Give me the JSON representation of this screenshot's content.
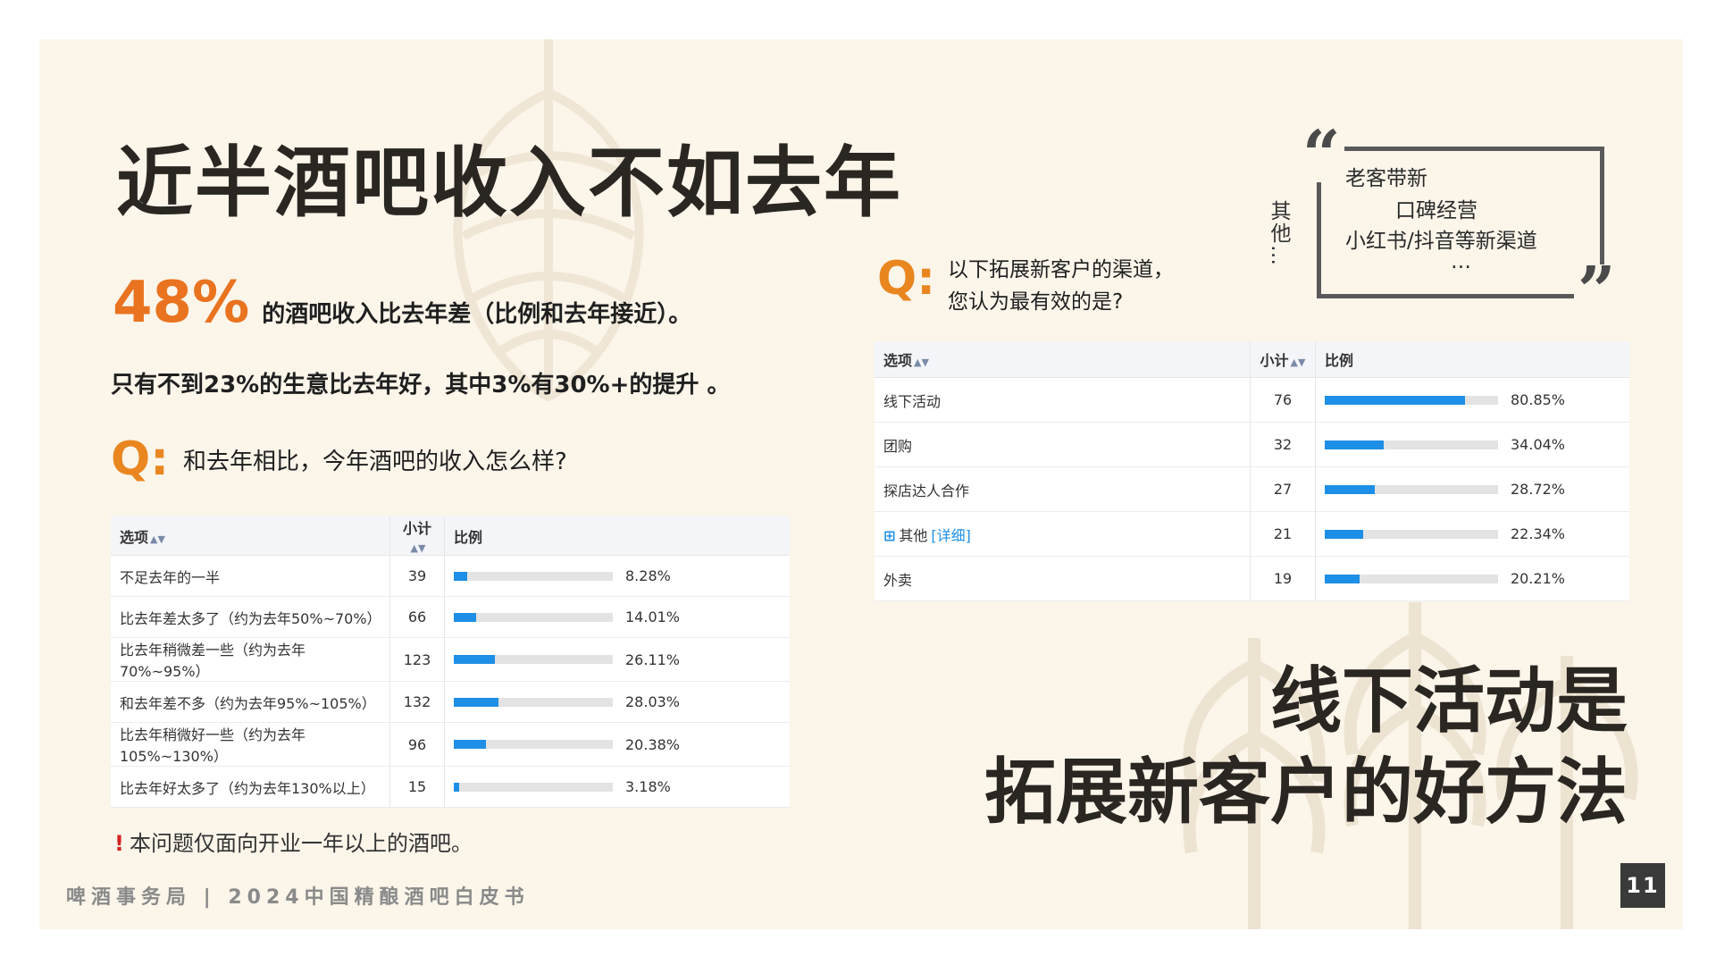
{
  "title": "近半酒吧收入不如去年",
  "stat": {
    "percent": "48%",
    "text": "的酒吧收入比去年差（比例和去年接近）。",
    "subline": "只有不到23%的生意比去年好，其中3%有30%+的提升 。"
  },
  "q_mark": "Q:",
  "q1": {
    "question": "和去年相比，今年酒吧的收入怎么样?",
    "headers": {
      "option": "选项",
      "count": "小计",
      "ratio": "比例"
    },
    "rows": [
      {
        "option": "不足去年的一半",
        "count": "39",
        "pct_label": "8.28%",
        "pct": 8.28
      },
      {
        "option": "比去年差太多了（约为去年50%~70%）",
        "count": "66",
        "pct_label": "14.01%",
        "pct": 14.01
      },
      {
        "option": "比去年稍微差一些（约为去年70%~95%）",
        "count": "123",
        "pct_label": "26.11%",
        "pct": 26.11
      },
      {
        "option": "和去年差不多（约为去年95%~105%）",
        "count": "132",
        "pct_label": "28.03%",
        "pct": 28.03
      },
      {
        "option": "比去年稍微好一些（约为去年105%~130%）",
        "count": "96",
        "pct_label": "20.38%",
        "pct": 20.38
      },
      {
        "option": "比去年好太多了（约为去年130%以上）",
        "count": "15",
        "pct_label": "3.18%",
        "pct": 3.18
      }
    ],
    "note_mark": "!",
    "note": "本问题仅面向开业一年以上的酒吧。"
  },
  "q2": {
    "question_line1": "以下拓展新客户的渠道，",
    "question_line2": "您认为最有效的是?",
    "headers": {
      "option": "选项",
      "count": "小计",
      "ratio": "比例"
    },
    "rows": [
      {
        "option": "线下活动",
        "count": "76",
        "pct_label": "80.85%",
        "pct": 80.85
      },
      {
        "option": "团购",
        "count": "32",
        "pct_label": "34.04%",
        "pct": 34.04
      },
      {
        "option": "探店达人合作",
        "count": "27",
        "pct_label": "28.72%",
        "pct": 28.72
      },
      {
        "option": "其他",
        "detail": "[详细]",
        "count": "21",
        "pct_label": "22.34%",
        "pct": 22.34
      },
      {
        "option": "外卖",
        "count": "19",
        "pct_label": "20.21%",
        "pct": 20.21
      }
    ]
  },
  "other_label": "其他…",
  "quote": {
    "line1": "老客带新",
    "line2": "口碑经营",
    "line3": "小红书/抖音等新渠道",
    "line4": "…"
  },
  "conclusion": {
    "line1": "线下活动是",
    "line2": "拓展新客户的好方法"
  },
  "footer": "啤酒事务局 | 2024中国精酿酒吧白皮书",
  "page_number": "11",
  "colors": {
    "accent": "#e9731f",
    "bar": "#1e8fe6",
    "track": "#e3e3e3",
    "background": "#fbf5ea"
  }
}
